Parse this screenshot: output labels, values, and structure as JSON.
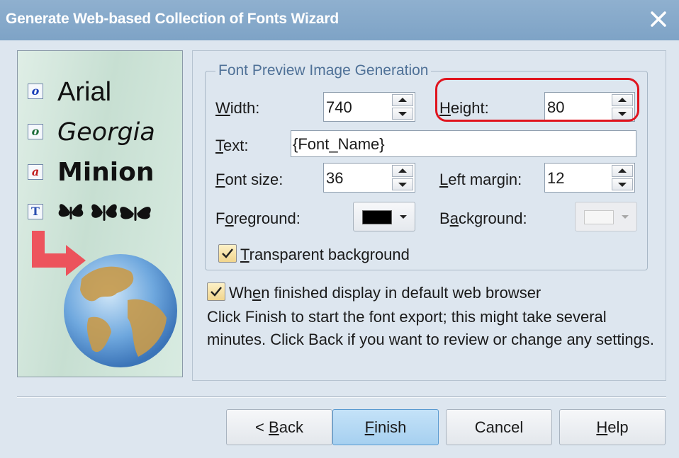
{
  "window": {
    "title": "Generate Web-based Collection of Fonts Wizard"
  },
  "sidebar": {
    "fonts": [
      {
        "icon": "opentype-font-icon",
        "glyph": "o",
        "name": "Arial",
        "color": "#1a3fb8"
      },
      {
        "icon": "opentype-font-icon",
        "glyph": "o",
        "name": "Georgia",
        "color": "#1c6e3a"
      },
      {
        "icon": "type1-font-icon",
        "glyph": "a",
        "name": "Minion",
        "color": "#c21d1d"
      },
      {
        "icon": "truetype-font-icon",
        "glyph": "T",
        "name": "",
        "color": "#2a4fb0"
      }
    ],
    "butterflies": "dingbat-butterflies",
    "arrow": "red-arrow-icon",
    "globe": "globe-icon"
  },
  "group": {
    "legend": "Font Preview Image Generation"
  },
  "fields": {
    "width": {
      "label_pre": "",
      "label_u": "W",
      "label_post": "idth:",
      "value": "740"
    },
    "height": {
      "label_pre": "",
      "label_u": "H",
      "label_post": "eight:",
      "value": "80"
    },
    "text": {
      "label_pre": "",
      "label_u": "T",
      "label_post": "ext:",
      "value": "{Font_Name}"
    },
    "font_size": {
      "label_pre": "",
      "label_u": "F",
      "label_post": "ont size:",
      "value": "36"
    },
    "left_margin": {
      "label_pre": "",
      "label_u": "L",
      "label_post": "eft margin:",
      "value": "12"
    },
    "foreground": {
      "label_pre": "F",
      "label_u": "o",
      "label_post": "reground:",
      "color": "#000000"
    },
    "background": {
      "label_pre": "B",
      "label_u": "a",
      "label_post": "ckground:",
      "color": "#f3f3f3"
    },
    "transparent": {
      "label_u": "T",
      "label_post": "ransparent background",
      "checked": true
    }
  },
  "finish_display": {
    "label_pre": "Wh",
    "label_u": "e",
    "label_post": "n finished display in default web browser",
    "checked": true
  },
  "message": "Click Finish to start the font export; this might take several minutes. Click Back if you want to review or change any settings.",
  "buttons": {
    "back": {
      "pre": "< ",
      "u": "B",
      "post": "ack"
    },
    "finish": {
      "pre": "",
      "u": "F",
      "post": "inish"
    },
    "cancel": {
      "pre": "",
      "u": "",
      "post": "Cancel"
    },
    "help": {
      "pre": "",
      "u": "H",
      "post": "elp"
    }
  }
}
